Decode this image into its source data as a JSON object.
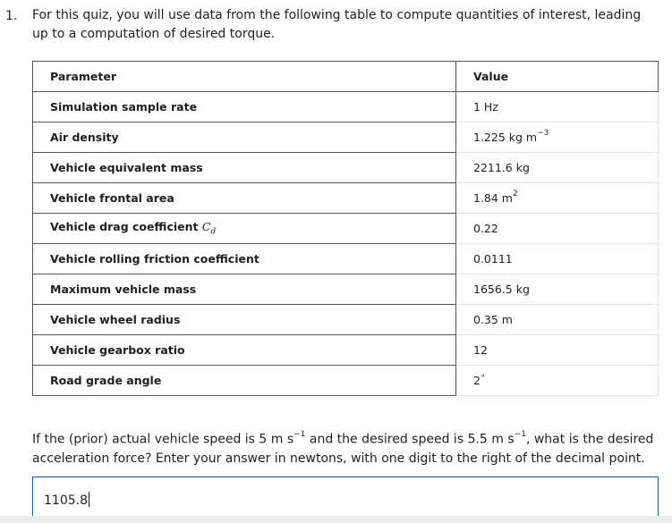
{
  "question": {
    "number": "1.",
    "intro": "For this quiz, you will use data from the following table to compute quantities of interest, leading up to a computation of desired torque.",
    "prompt_part1": "If the (prior) actual vehicle speed is 5 m s",
    "prompt_exp1": "−1",
    "prompt_part2": " and the desired speed is 5.5 m s",
    "prompt_exp2": "−1",
    "prompt_part3": ", what is the desired acceleration force? Enter your answer in newtons, with one digit to the right of the decimal point."
  },
  "table": {
    "headers": {
      "parameter": "Parameter",
      "value": "Value"
    },
    "rows": [
      {
        "name": "Simulation sample rate",
        "value": "1 Hz"
      },
      {
        "name": "Air density",
        "value": "1.225 kg m",
        "exp": "−3"
      },
      {
        "name": "Vehicle equivalent mass",
        "value": "2211.6 kg"
      },
      {
        "name": "Vehicle frontal area",
        "value": "1.84 m",
        "exp": "2"
      },
      {
        "name": "Vehicle drag coefficient ",
        "symbol": "C",
        "symbol_sub": "d",
        "value": "0.22"
      },
      {
        "name": "Vehicle rolling friction coefficient",
        "value": "0.0111"
      },
      {
        "name": "Maximum vehicle mass",
        "value": "1656.5 kg"
      },
      {
        "name": "Vehicle wheel radius",
        "value": "0.35 m"
      },
      {
        "name": "Vehicle gearbox ratio",
        "value": "12"
      },
      {
        "name": "Road grade angle",
        "value": "2",
        "exp": "∘"
      }
    ]
  },
  "answer": {
    "value": "1105.8"
  }
}
